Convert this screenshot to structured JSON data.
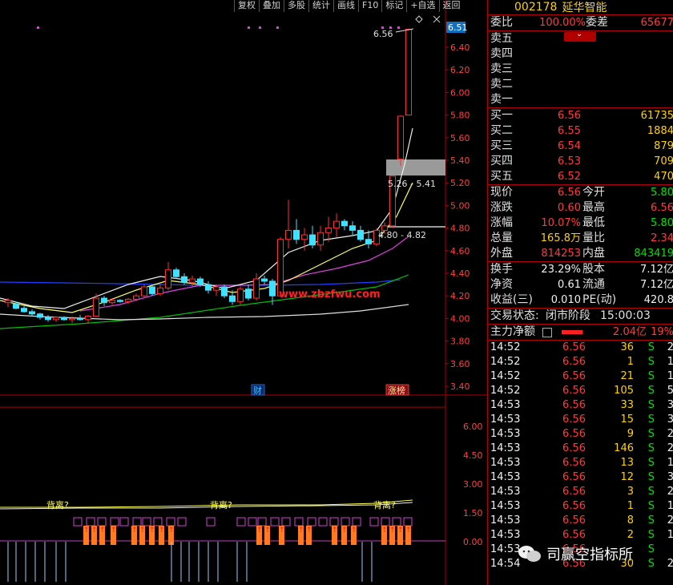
{
  "toolbar": [
    "复权",
    "叠加",
    "多股",
    "统计",
    "画线",
    "F10",
    "标记",
    "+自选",
    "返回"
  ],
  "price_axis": [
    "6.40",
    "6.20",
    "6.00",
    "5.80",
    "5.60",
    "5.40",
    "5.20",
    "5.00",
    "4.80",
    "4.60",
    "4.40",
    "4.20",
    "4.00",
    "3.80",
    "3.60",
    "3.40"
  ],
  "current_price_tag": "6.51",
  "high_label": "6.56",
  "gap_upper_label": "5.26 - 5.41",
  "gap_lower_label": "4.80 - 4.82",
  "watermark_url": "www.zbzfwu.com",
  "event_markers": {
    "finance": "财",
    "limit_list": "涨榜"
  },
  "indicator_axis": [
    "6.00",
    "4.50",
    "3.00",
    "1.50",
    "0.00"
  ],
  "divergence_label": "背离?",
  "stock": {
    "code": "002178",
    "name": "延华智能"
  },
  "order_book": {
    "wei_bi_label": "委比",
    "wei_bi": "100.00%",
    "wei_cha_label": "委差",
    "wei_cha": "65677",
    "asks": [
      "卖五",
      "卖四",
      "卖三",
      "卖二",
      "卖一"
    ],
    "bids": [
      {
        "label": "买一",
        "price": "6.56",
        "vol": "61735"
      },
      {
        "label": "买二",
        "price": "6.55",
        "vol": "1884"
      },
      {
        "label": "买三",
        "price": "6.54",
        "vol": "879"
      },
      {
        "label": "买四",
        "price": "6.53",
        "vol": "709"
      },
      {
        "label": "买五",
        "price": "6.52",
        "vol": "470"
      }
    ]
  },
  "quote": [
    {
      "l1": "现价",
      "v1": "6.56",
      "l2": "今开",
      "v2": "5.80"
    },
    {
      "l1": "涨跌",
      "v1": "0.60",
      "l2": "最高",
      "v2": "6.56"
    },
    {
      "l1": "涨幅",
      "v1": "10.07%",
      "l2": "最低",
      "v2": "5.80"
    },
    {
      "l1": "总量",
      "v1": "165.8万",
      "l2": "量比",
      "v2": "2.34"
    },
    {
      "l1": "外盘",
      "v1": "814253",
      "l2": "内盘",
      "v2": "843419"
    }
  ],
  "fundamentals": [
    {
      "l1": "换手",
      "v1": "23.29%",
      "l2": "股本",
      "v2": "7.12亿"
    },
    {
      "l1": "净资",
      "v1": "0.61",
      "l2": "流通",
      "v2": "7.12亿"
    },
    {
      "l1": "收益(三)",
      "v1": "0.010",
      "l2": "PE(动)",
      "v2": "420.8"
    }
  ],
  "trade_status": {
    "label": "交易状态:",
    "value": "闭市阶段",
    "time": "15:00:03"
  },
  "main_flow": {
    "label": "主力净额",
    "value": "2.04亿",
    "pct": "19%"
  },
  "ticks": [
    [
      "14:52",
      "6.56",
      "36",
      "S",
      "2"
    ],
    [
      "14:52",
      "6.56",
      "1",
      "S",
      "1"
    ],
    [
      "14:52",
      "6.56",
      "21",
      "S",
      "1"
    ],
    [
      "14:52",
      "6.56",
      "105",
      "S",
      "5"
    ],
    [
      "14:53",
      "6.56",
      "33",
      "S",
      "3"
    ],
    [
      "14:53",
      "6.56",
      "15",
      "S",
      "3"
    ],
    [
      "14:53",
      "6.56",
      "9",
      "S",
      "2"
    ],
    [
      "14:53",
      "6.56",
      "146",
      "S",
      "2"
    ],
    [
      "14:53",
      "6.56",
      "13",
      "S",
      "1"
    ],
    [
      "14:53",
      "6.56",
      "12",
      "S",
      "3"
    ],
    [
      "14:53",
      "6.56",
      "3",
      "S",
      "2"
    ],
    [
      "14:53",
      "6.56",
      "1",
      "S",
      "1"
    ],
    [
      "14:53",
      "6.56",
      "8",
      "S",
      "2"
    ],
    [
      "14:53",
      "6.56",
      "2",
      "S",
      "1"
    ],
    [
      "14:53",
      "6.56",
      "",
      "S",
      ""
    ],
    [
      "14:54",
      "6.56",
      "30",
      "S",
      "2"
    ]
  ],
  "brand": "司赢空指标所",
  "chart_data": {
    "type": "candlestick",
    "ylim": [
      3.35,
      6.55
    ],
    "candles": [
      [
        4.14,
        4.18,
        4.1,
        4.16
      ],
      [
        4.13,
        4.15,
        4.08,
        4.09
      ],
      [
        4.09,
        4.11,
        4.05,
        4.06
      ],
      [
        4.06,
        4.08,
        4.02,
        4.04
      ],
      [
        4.04,
        4.05,
        3.99,
        4.01
      ],
      [
        4.01,
        4.03,
        3.97,
        3.99
      ],
      [
        3.99,
        4.02,
        3.97,
        4.01
      ],
      [
        4.01,
        4.02,
        3.98,
        3.99
      ],
      [
        3.99,
        4.02,
        3.96,
        4.0
      ],
      [
        4.0,
        4.03,
        3.98,
        3.99
      ],
      [
        3.99,
        4.03,
        3.96,
        4.02
      ],
      [
        4.02,
        4.22,
        4.02,
        4.18
      ],
      [
        4.18,
        4.2,
        4.11,
        4.14
      ],
      [
        4.14,
        4.18,
        4.12,
        4.16
      ],
      [
        4.16,
        4.17,
        4.14,
        4.15
      ],
      [
        4.15,
        4.18,
        4.13,
        4.17
      ],
      [
        4.17,
        4.22,
        4.15,
        4.2
      ],
      [
        4.2,
        4.3,
        4.18,
        4.28
      ],
      [
        4.28,
        4.3,
        4.2,
        4.22
      ],
      [
        4.22,
        4.3,
        4.2,
        4.27
      ],
      [
        4.27,
        4.5,
        4.25,
        4.43
      ],
      [
        4.43,
        4.45,
        4.35,
        4.37
      ],
      [
        4.37,
        4.4,
        4.3,
        4.32
      ],
      [
        4.32,
        4.38,
        4.28,
        4.35
      ],
      [
        4.35,
        4.37,
        4.28,
        4.3
      ],
      [
        4.3,
        4.33,
        4.22,
        4.25
      ],
      [
        4.25,
        4.3,
        4.2,
        4.28
      ],
      [
        4.28,
        4.3,
        4.18,
        4.2
      ],
      [
        4.2,
        4.25,
        4.12,
        4.15
      ],
      [
        4.15,
        4.28,
        4.12,
        4.26
      ],
      [
        4.26,
        4.3,
        4.16,
        4.18
      ],
      [
        4.18,
        4.4,
        4.16,
        4.35
      ],
      [
        4.35,
        4.38,
        4.3,
        4.33
      ],
      [
        4.33,
        4.35,
        4.12,
        4.2
      ],
      [
        4.2,
        4.72,
        4.2,
        4.7
      ],
      [
        4.7,
        5.05,
        4.62,
        4.78
      ],
      [
        4.78,
        4.88,
        4.66,
        4.7
      ],
      [
        4.7,
        4.8,
        4.6,
        4.74
      ],
      [
        4.74,
        4.82,
        4.62,
        4.65
      ],
      [
        4.65,
        4.82,
        4.6,
        4.76
      ],
      [
        4.76,
        4.9,
        4.68,
        4.8
      ],
      [
        4.8,
        4.93,
        4.72,
        4.86
      ],
      [
        4.86,
        4.88,
        4.78,
        4.82
      ],
      [
        4.82,
        4.86,
        4.74,
        4.78
      ],
      [
        4.78,
        4.82,
        4.68,
        4.7
      ],
      [
        4.7,
        4.78,
        4.62,
        4.66
      ],
      [
        4.66,
        4.8,
        4.64,
        4.78
      ],
      [
        4.78,
        4.85,
        4.75,
        4.82
      ],
      [
        4.82,
        5.26,
        4.8,
        5.26
      ],
      [
        5.41,
        5.8,
        5.35,
        5.79
      ],
      [
        5.8,
        6.56,
        5.8,
        6.56
      ]
    ]
  }
}
